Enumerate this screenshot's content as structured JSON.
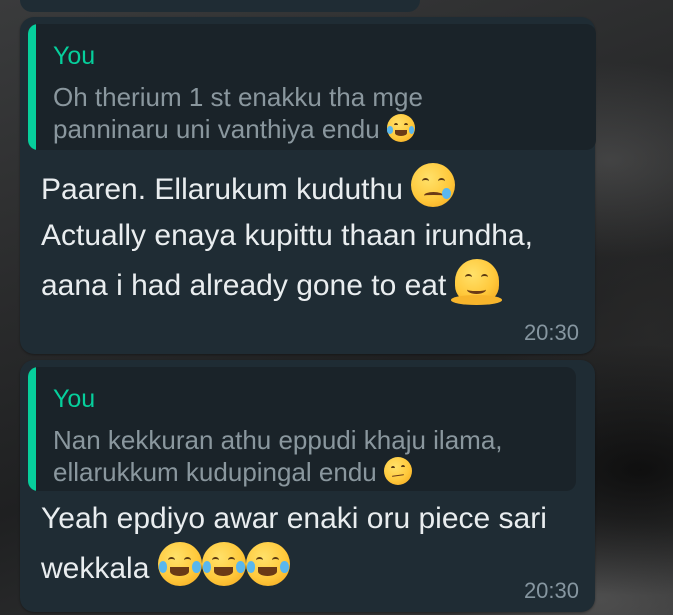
{
  "messages": [
    {
      "quote_author": "You",
      "quote_lines": [
        "Oh therium 1 st enakku tha mge",
        "panninaru uni vanthiya endu"
      ],
      "quote_emoji": "tears-of-joy-emoji",
      "text_lines": [
        "Paaren. Ellarukum kuduthu",
        "Actually enaya kupittu thaan irundha,",
        "aana i had already gone to eat"
      ],
      "line_emojis": [
        "sad-but-relieved-emoji",
        "",
        "melting-face-emoji"
      ],
      "time": "20:30"
    },
    {
      "quote_author": "You",
      "quote_lines": [
        "Nan kekkuran athu eppudi khaju ilama,",
        "ellarukkum kudupingal endu"
      ],
      "quote_emoji": "face-with-raised-eyebrow-emoji",
      "text_lines": [
        "Yeah epdiyo awar enaki oru piece sari",
        "wekkala"
      ],
      "line_emojis": [
        "",
        "tears-of-joy-emoji x3"
      ],
      "time": "20:30"
    }
  ],
  "colors": {
    "bubble": "#1f2c34",
    "quote_bg": "#1a2329",
    "accent": "#06cf9c",
    "text": "#e9edef",
    "muted": "#8696a0"
  }
}
